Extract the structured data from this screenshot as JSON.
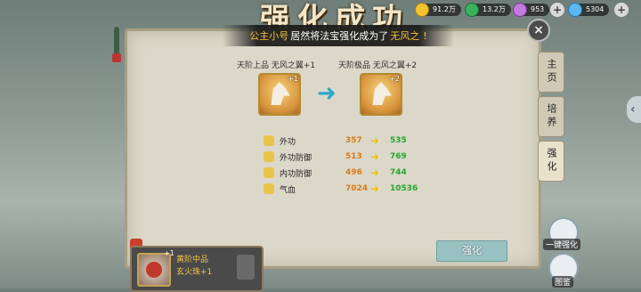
{
  "title": "强化成功",
  "resources": [
    {
      "name": "gold-coin",
      "value": "91.2万",
      "color": "#f2c230"
    },
    {
      "name": "silver",
      "value": "13.2万",
      "color": "#39b25c"
    },
    {
      "name": "jade",
      "value": "953",
      "color": "#c07ae0"
    },
    {
      "name": "diamond",
      "value": "5304",
      "color": "#5ab7f2"
    }
  ],
  "banner": {
    "player": "公主小号",
    "middle": "居然将法宝强化成为了",
    "item": "无风之",
    "end": "!"
  },
  "before_item": {
    "name": "天阶上品 无风之翼+1",
    "level": "+1"
  },
  "after_item": {
    "name": "天阶极品 无风之翼+2",
    "level": "+2"
  },
  "stats": [
    {
      "name": "外功",
      "old": "357",
      "new": "535"
    },
    {
      "name": "外功防御",
      "old": "513",
      "new": "769"
    },
    {
      "name": "内功防御",
      "old": "496",
      "new": "744"
    },
    {
      "name": "气血",
      "old": "7024",
      "new": "10536"
    }
  ],
  "side_tabs": [
    "主页",
    "培养",
    "强化"
  ],
  "bottom_card": {
    "line1": "黄阶中品",
    "line2": "玄火珠+1",
    "level": "+1"
  },
  "strength_button": "强化",
  "one_key_label": "一键强化",
  "gallery_label": "图鉴"
}
